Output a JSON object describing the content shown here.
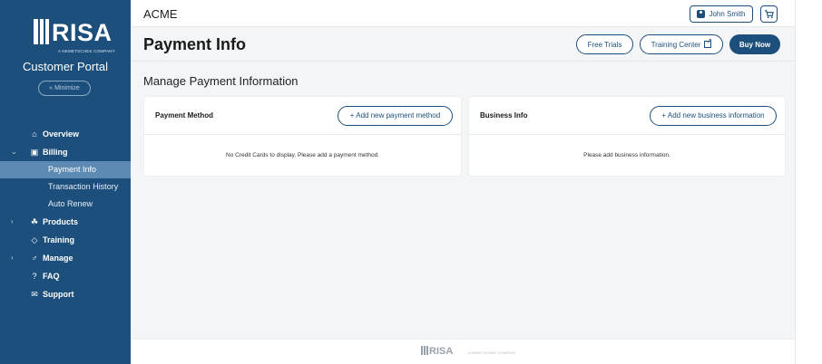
{
  "sidebar": {
    "logo_text": "RISA",
    "logo_tagline": "A NEMETSCHEK COMPANY",
    "portal_title": "Customer Portal",
    "minimize_label": "« Minimize",
    "nav": [
      {
        "label": "Overview",
        "icon": "home-icon",
        "glyph": "⌂"
      },
      {
        "label": "Billing",
        "icon": "billing-icon",
        "glyph": "▣",
        "caret": "⌄"
      },
      {
        "label": "Products",
        "icon": "products-icon",
        "glyph": "☘",
        "caret": "›"
      },
      {
        "label": "Training",
        "icon": "training-icon",
        "glyph": "◇"
      },
      {
        "label": "Manage",
        "icon": "manage-icon",
        "glyph": "♂",
        "caret": "›"
      },
      {
        "label": "FAQ",
        "icon": "question-icon",
        "glyph": "?"
      },
      {
        "label": "Support",
        "icon": "support-icon",
        "glyph": "✉"
      }
    ],
    "billing_subitems": [
      "Payment Info",
      "Transaction History",
      "Auto Renew"
    ],
    "active_subitem": "Payment Info",
    "colors": {
      "background": "#1c4f7c",
      "active": "#5c8ab3"
    }
  },
  "header": {
    "brand": "ACME",
    "user_name": "John Smith",
    "cart_glyph": "🛒"
  },
  "page": {
    "title": "Payment Info",
    "buttons": {
      "free_trials": "Free Trials",
      "training_center": "Training Center",
      "buy_now": "Buy Now"
    }
  },
  "main": {
    "section_title": "Manage Payment Information",
    "payment_card": {
      "title": "Payment Method",
      "button": "+ Add new payment method",
      "message": "No Credit Cards to display. Please add a payment method."
    },
    "business_card": {
      "title": "Business Info",
      "button": "+ Add new business information",
      "message": "Please add business information."
    }
  },
  "footer": {
    "logo_text": "RISA",
    "tagline": "A NEMETSCHEK COMPANY"
  }
}
